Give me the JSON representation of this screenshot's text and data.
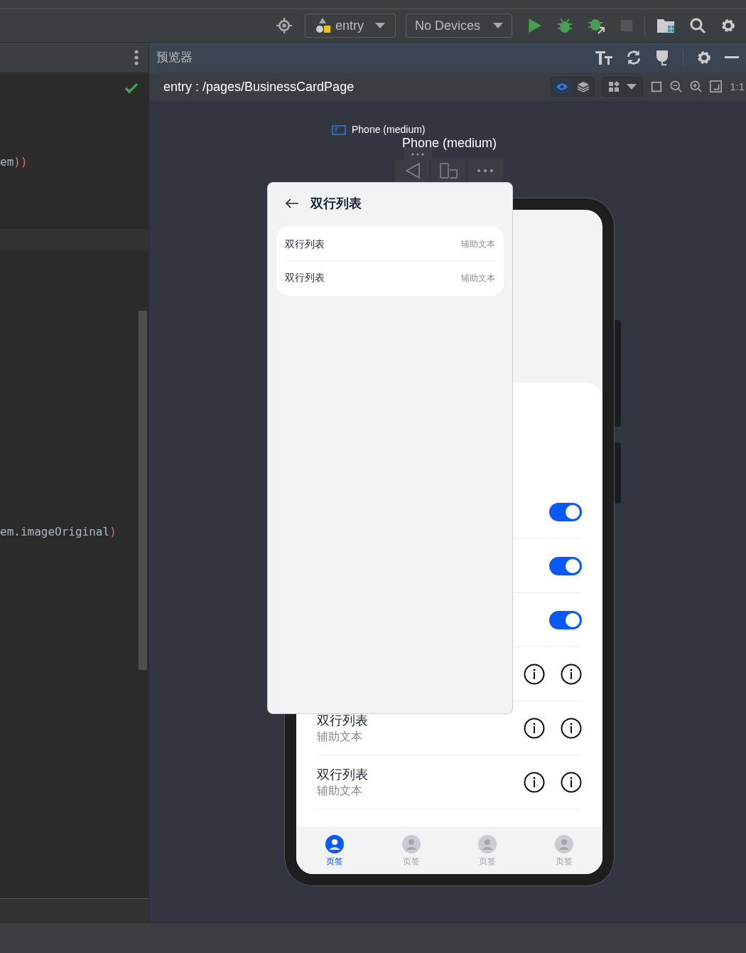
{
  "toolbar": {
    "module": "entry",
    "device": "No Devices"
  },
  "code_panel": {
    "lines": [
      {
        "code": "em",
        "paren": "))"
      },
      {
        "code": "em.imageOriginal",
        "paren": ")"
      }
    ]
  },
  "preview": {
    "title": "预览器",
    "path": "entry : /pages/BusinessCardPage",
    "zoom_ratio": "1:1",
    "device_label": "Phone (medium)",
    "device_caption": "Phone (medium)",
    "popup": {
      "title": "双行列表",
      "rows": [
        {
          "title": "双行列表",
          "aux": "辅助文本"
        },
        {
          "title": "双行列表",
          "aux": "辅助文本"
        }
      ]
    },
    "phone": {
      "rows": [
        {
          "kind": "toggle",
          "on": true
        },
        {
          "kind": "toggle",
          "on": true
        },
        {
          "kind": "toggle",
          "on": true
        },
        {
          "kind": "info"
        },
        {
          "kind": "info",
          "title": "双行列表",
          "subtitle": "辅助文本"
        },
        {
          "kind": "info",
          "title": "双行列表",
          "subtitle": "辅助文本"
        }
      ],
      "tabs": [
        {
          "label": "页签",
          "selected": true
        },
        {
          "label": "页签",
          "selected": false
        },
        {
          "label": "页签",
          "selected": false
        },
        {
          "label": "页签",
          "selected": false
        }
      ]
    }
  }
}
